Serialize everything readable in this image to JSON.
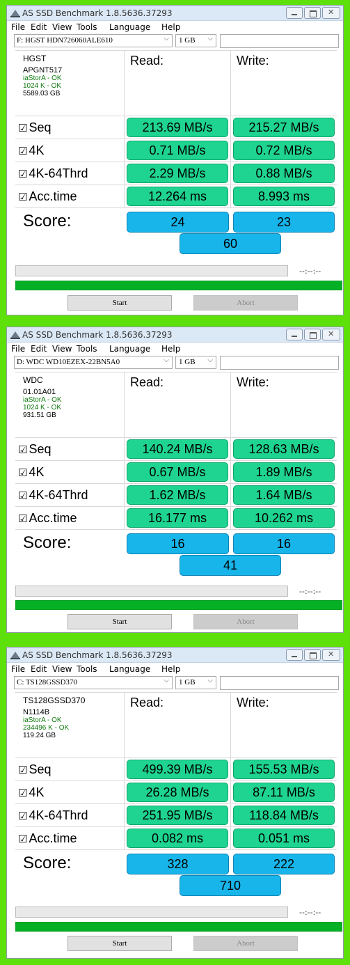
{
  "windows": [
    {
      "title": "AS SSD Benchmark 1.8.5636.37293",
      "menu": [
        "File",
        "Edit",
        "View",
        "Tools",
        "Language",
        "Help"
      ],
      "drive": "F: HGST HDN726060ALE610",
      "size": "1 GB",
      "info": {
        "model": "HGST",
        "firmware": "APGNT517",
        "driver": "iaStorA - OK",
        "alignment": "1024 K - OK",
        "capacity": "5589.03 GB"
      },
      "headers": {
        "read": "Read:",
        "write": "Write:"
      },
      "rows": [
        {
          "label": "Seq",
          "read": "213.69 MB/s",
          "write": "215.27 MB/s"
        },
        {
          "label": "4K",
          "read": "0.71 MB/s",
          "write": "0.72 MB/s"
        },
        {
          "label": "4K-64Thrd",
          "read": "2.29 MB/s",
          "write": "0.88 MB/s"
        },
        {
          "label": "Acc.time",
          "read": "12.264 ms",
          "write": "8.993 ms"
        }
      ],
      "score_label": "Score:",
      "score": {
        "read": "24",
        "write": "23",
        "total": "60"
      },
      "time": "--:--:--",
      "start": "Start",
      "abort": "Abort"
    },
    {
      "title": "AS SSD Benchmark 1.8.5636.37293",
      "menu": [
        "File",
        "Edit",
        "View",
        "Tools",
        "Language",
        "Help"
      ],
      "drive": "D: WDC WD10EZEX-22BN5A0",
      "size": "1 GB",
      "info": {
        "model": "WDC",
        "firmware": "01.01A01",
        "driver": "iaStorA - OK",
        "alignment": "1024 K - OK",
        "capacity": "931.51 GB"
      },
      "headers": {
        "read": "Read:",
        "write": "Write:"
      },
      "rows": [
        {
          "label": "Seq",
          "read": "140.24 MB/s",
          "write": "128.63 MB/s"
        },
        {
          "label": "4K",
          "read": "0.67 MB/s",
          "write": "1.89 MB/s"
        },
        {
          "label": "4K-64Thrd",
          "read": "1.62 MB/s",
          "write": "1.64 MB/s"
        },
        {
          "label": "Acc.time",
          "read": "16.177 ms",
          "write": "10.262 ms"
        }
      ],
      "score_label": "Score:",
      "score": {
        "read": "16",
        "write": "16",
        "total": "41"
      },
      "time": "--:--:--",
      "start": "Start",
      "abort": "Abort"
    },
    {
      "title": "AS SSD Benchmark 1.8.5636.37293",
      "menu": [
        "File",
        "Edit",
        "View",
        "Tools",
        "Language",
        "Help"
      ],
      "drive": "C: TS128GSSD370",
      "size": "1 GB",
      "info": {
        "model": "TS128GSSD370",
        "firmware": "N1114B",
        "driver": "iaStorA - OK",
        "alignment": "234496 K - OK",
        "capacity": "119.24 GB"
      },
      "headers": {
        "read": "Read:",
        "write": "Write:"
      },
      "rows": [
        {
          "label": "Seq",
          "read": "499.39 MB/s",
          "write": "155.53 MB/s"
        },
        {
          "label": "4K",
          "read": "26.28 MB/s",
          "write": "87.11 MB/s"
        },
        {
          "label": "4K-64Thrd",
          "read": "251.95 MB/s",
          "write": "118.84 MB/s"
        },
        {
          "label": "Acc.time",
          "read": "0.082 ms",
          "write": "0.051 ms"
        }
      ],
      "score_label": "Score:",
      "score": {
        "read": "328",
        "write": "222",
        "total": "710"
      },
      "time": "--:--:--",
      "start": "Start",
      "abort": "Abort"
    }
  ],
  "icons": {
    "app": "disk-drive-icon",
    "checkbox": "checkbox-checked-icon",
    "dropdown": "chevron-down-icon"
  },
  "colors": {
    "background": "#5ee10a",
    "value_cell": "#1fd490",
    "score_cell": "#18b5ea",
    "progress_done": "#06b025"
  }
}
